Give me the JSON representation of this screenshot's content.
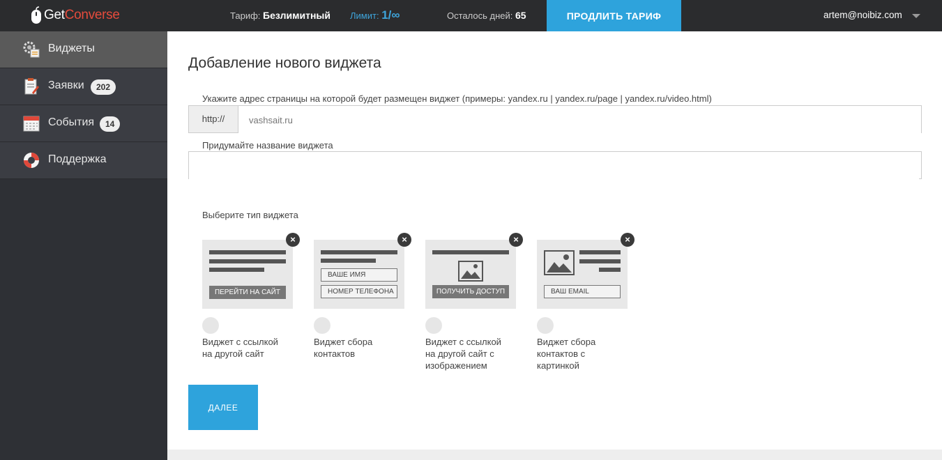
{
  "app": {
    "logo_get": "Get",
    "logo_converse": "Converse"
  },
  "topbar": {
    "plan_label": "Тариф:",
    "plan_value": "Безлимитный",
    "limit_label": "Лимит:",
    "limit_value": "1/∞",
    "days_label": "Осталось дней:",
    "days_value": "65",
    "extend_button": "ПРОДЛИТЬ ТАРИФ",
    "user_email": "artem@noibiz.com"
  },
  "sidebar": {
    "items": [
      {
        "label": "Виджеты",
        "icon": "widgets-gear-icon",
        "active": true
      },
      {
        "label": "Заявки",
        "icon": "requests-clipboard-icon",
        "badge": "202"
      },
      {
        "label": "События",
        "icon": "events-calendar-icon",
        "badge": "14"
      },
      {
        "label": "Поддержка",
        "icon": "support-lifebuoy-icon"
      }
    ]
  },
  "main": {
    "title": "Добавление нового виджета",
    "url_label": "Укажите адрес страницы на которой будет размещен виджет (примеры: yandex.ru | yandex.ru/page | yandex.ru/video.html)",
    "url_prefix": "http://",
    "url_placeholder": "vashsait.ru",
    "name_label": "Придумайте название виджета",
    "name_value": "",
    "type_label": "Выберите тип виджета",
    "widget_types": [
      {
        "label_line1": "Виджет с ссылкой",
        "label_line2": "на другой сайт",
        "label_line3": "",
        "button": "ПЕРЕЙТИ НА САЙТ"
      },
      {
        "label_line1": "Виджет сбора",
        "label_line2": "контактов",
        "label_line3": "",
        "field1": "ВАШЕ ИМЯ",
        "field2": "НОМЕР ТЕЛЕФОНА"
      },
      {
        "label_line1": "Виджет с ссылкой",
        "label_line2": "на другой сайт с",
        "label_line3": "изображением",
        "button": "ПОЛУЧИТЬ ДОСТУП"
      },
      {
        "label_line1": "Виджет сбора",
        "label_line2": "контактов с",
        "label_line3": "картинкой",
        "field1": "ВАШ EMAIL"
      }
    ],
    "next_button": "ДАЛЕЕ"
  },
  "colors": {
    "accent": "#2ea3dc",
    "topbar": "#2b2c2e",
    "sidebar": "#2e3035",
    "logo_red": "#e54b3c"
  }
}
